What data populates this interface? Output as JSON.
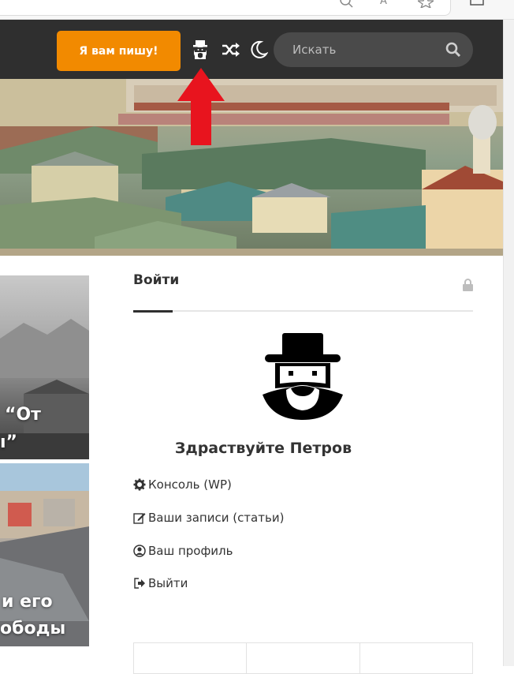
{
  "header": {
    "write_button": "Я вам пишу!",
    "search_placeholder": "Искать"
  },
  "thumbs": [
    {
      "caption_lines": [
        "“От",
        "ı”"
      ]
    },
    {
      "caption_lines": [
        "и его",
        "ободы"
      ]
    }
  ],
  "login_widget": {
    "title": "Войти",
    "greeting": "Здраствуйте Петров",
    "links": [
      {
        "label": "Консоль (WP)",
        "icon": "gear-icon"
      },
      {
        "label": "Ваши записи (статьи)",
        "icon": "edit-icon"
      },
      {
        "label": "Ваш профиль",
        "icon": "user-circle-icon"
      },
      {
        "label": "Выйти",
        "icon": "sign-out-icon"
      }
    ]
  },
  "colors": {
    "header_bg": "#2f2f2f",
    "accent": "#f28a00",
    "arrow": "#e8141e"
  }
}
